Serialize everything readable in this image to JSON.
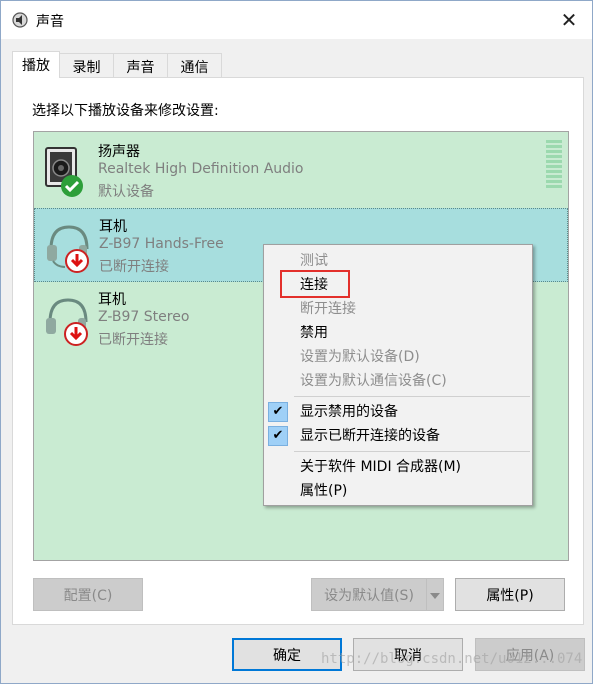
{
  "window": {
    "title": "声音",
    "close_glyph": "✕"
  },
  "tabs": [
    {
      "label": "播放"
    },
    {
      "label": "录制"
    },
    {
      "label": "声音"
    },
    {
      "label": "通信"
    }
  ],
  "panel": {
    "instruction": "选择以下播放设备来修改设置:",
    "devices": [
      {
        "name": "扬声器",
        "description": "Realtek High Definition Audio",
        "status": "默认设备",
        "icon": "speaker-icon",
        "badge": "green-check-badge-icon"
      },
      {
        "name": "耳机",
        "description": "Z-B97 Hands-Free",
        "status": "已断开连接",
        "icon": "headset-icon",
        "badge": "red-down-arrow-badge-icon"
      },
      {
        "name": "耳机",
        "description": "Z-B97 Stereo",
        "status": "已断开连接",
        "icon": "headset-icon",
        "badge": "red-down-arrow-badge-icon"
      }
    ],
    "buttons": {
      "configure": "配置(C)",
      "set_default": "设为默认值(S)",
      "properties": "属性(P)"
    }
  },
  "context_menu": {
    "items": [
      {
        "label": "测试",
        "enabled": false
      },
      {
        "label": "连接",
        "enabled": true
      },
      {
        "label": "断开连接",
        "enabled": false
      },
      {
        "label": "禁用",
        "enabled": true
      },
      {
        "label": "设置为默认设备(D)",
        "enabled": false
      },
      {
        "label": "设置为默认通信设备(C)",
        "enabled": false
      },
      {
        "label": "显示禁用的设备",
        "enabled": true,
        "checked": true
      },
      {
        "label": "显示已断开连接的设备",
        "enabled": true,
        "checked": true
      },
      {
        "label": "关于软件 MIDI 合成器(M)",
        "enabled": true
      },
      {
        "label": "属性(P)",
        "enabled": true
      }
    ],
    "check_glyph": "✔"
  },
  "footer": {
    "ok": "确定",
    "cancel": "取消",
    "apply": "应用(A)"
  },
  "watermark": "http://blog.csdn.net/u012...074",
  "colors": {
    "list_bg": "#c9ebd2",
    "selected_bg": "#a7dede",
    "highlight_border": "#e3302c",
    "accent": "#0078d7"
  }
}
